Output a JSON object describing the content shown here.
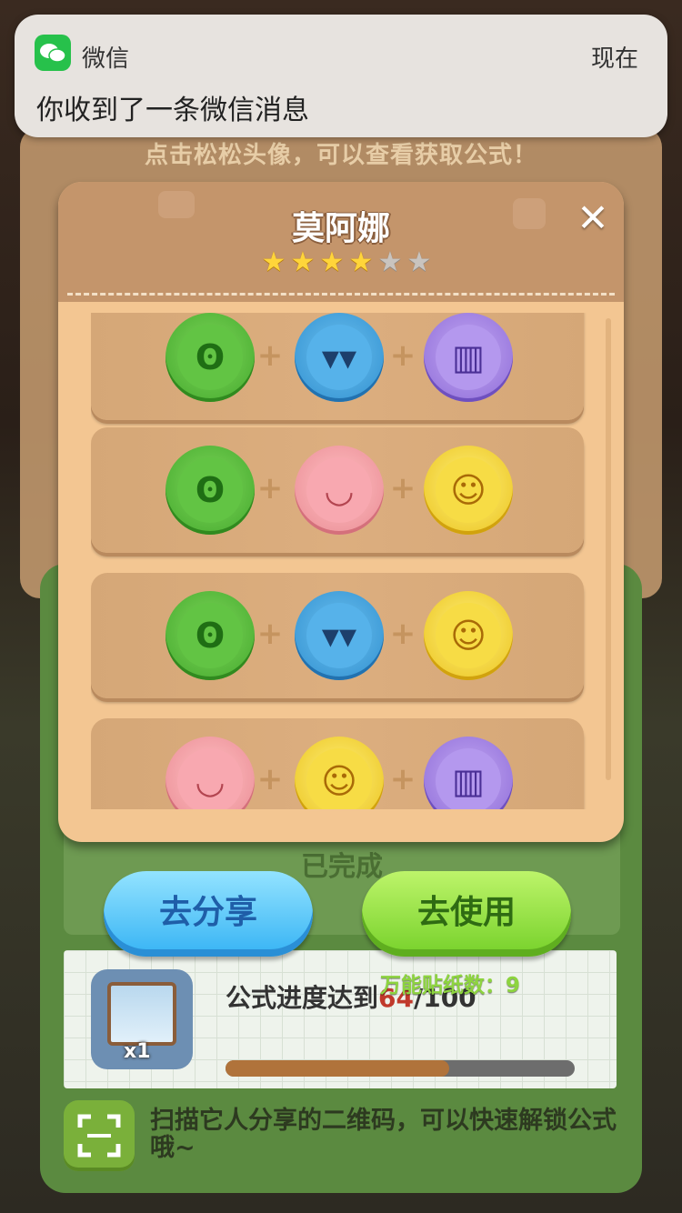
{
  "notification": {
    "app_name": "微信",
    "time": "现在",
    "message": "你收到了一条微信消息",
    "icon": "wechat-icon"
  },
  "background": {
    "hint": "点击松松头像，可以查看获取公式！",
    "completed_label": "已完成",
    "progress": {
      "label_prefix": "公式进度达到",
      "current": "64",
      "total": "/100",
      "fraction": 0.64
    },
    "reward_count": "x1",
    "scan_text": "扫描它人分享的二维码，可以快速解锁公式哦~"
  },
  "modal": {
    "title": "莫阿娜",
    "rating": 4,
    "rating_max": 6,
    "close_glyph": "✕",
    "plus_glyph": "+",
    "recipes": [
      [
        "ear",
        "cool-face",
        "comb"
      ],
      [
        "ear",
        "blush-face",
        "smile-face"
      ],
      [
        "ear",
        "cool-face",
        "smile-face"
      ],
      [
        "blush-face",
        "smile-face",
        "comb"
      ]
    ]
  },
  "actions": {
    "share_label": "去分享",
    "use_label": "去使用",
    "universal_stickers": "万能贴纸数：9"
  },
  "colors": {
    "share": "#36b3f4",
    "use": "#76d12a",
    "modal": "#f3c692",
    "header": "#c4956b"
  }
}
